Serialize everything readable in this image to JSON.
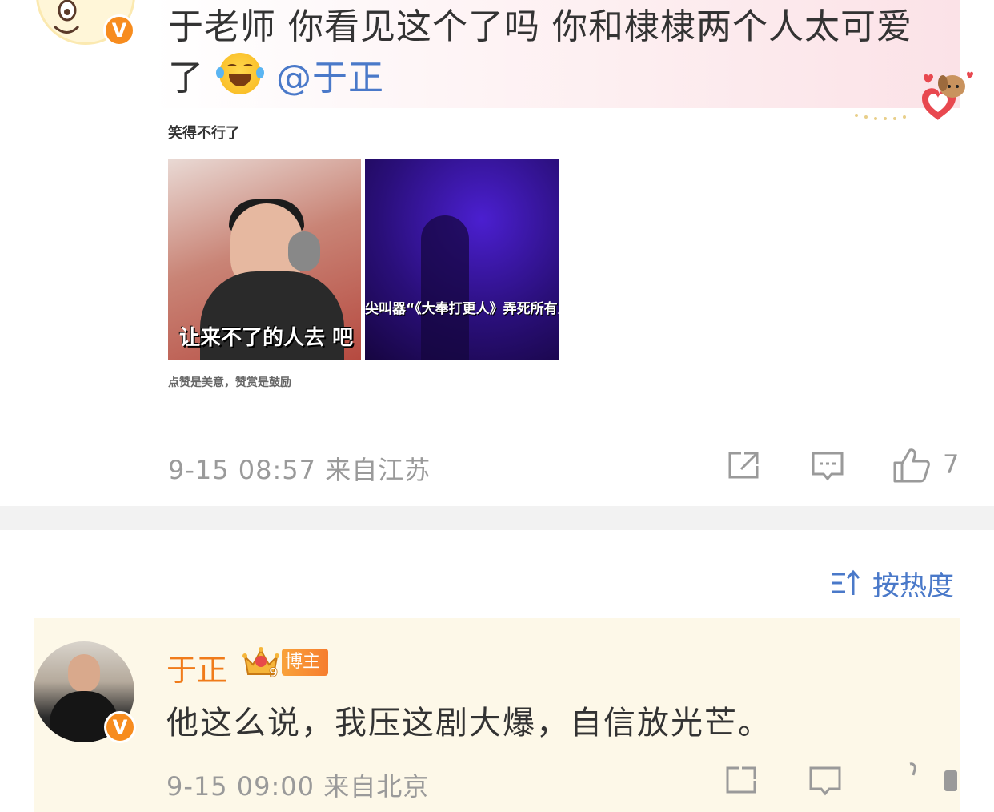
{
  "post": {
    "text_line1": "于老师 你看见这个了吗 你和棣棣两个人太可爱",
    "text_line2_prefix": "了",
    "mention": "@于正",
    "image_caption": "笑得不行了",
    "image_footer": "点赞是美意，赞赏是鼓励",
    "thumb1_caption": "让来不了的人去 吧",
    "thumb2_caption": "尖叫器“《大奉打更人》弄死所有人",
    "meta": "9-15 08:57  来自江苏",
    "like_count": "7",
    "avatar_badge": "V"
  },
  "sort": {
    "label": "按热度"
  },
  "comment": {
    "author": "于正",
    "badge_label": "博主",
    "badge_level": "9",
    "text": "他这么说，我压这剧大爆，自信放光芒。",
    "meta": "9-15 09:00  来自北京",
    "avatar_badge": "V"
  },
  "colors": {
    "accent_blue": "#4a79c9",
    "name_orange": "#f07b1a",
    "meta_gray": "#9a9a9a",
    "comment_bg": "#fdf8e8",
    "divider": "#f2f2f2"
  },
  "icons": {
    "share": "share-icon",
    "comment": "comment-icon",
    "like": "thumbs-up-icon",
    "sort": "sort-icon"
  }
}
